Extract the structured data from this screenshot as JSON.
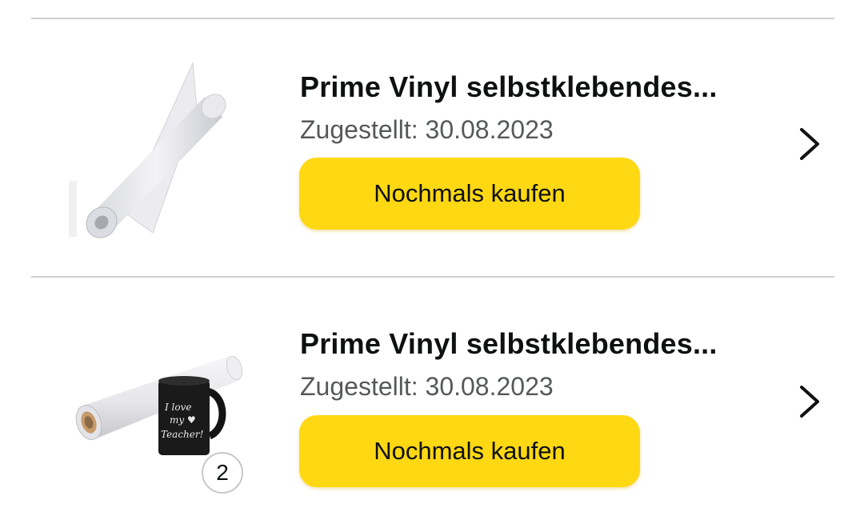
{
  "orders": [
    {
      "title": "Prime Vinyl selbstklebendes...",
      "delivered": "Zugestellt: 30.08.2023",
      "buy_again_label": "Nochmals kaufen",
      "thumbnail": "white-vinyl-roll-image",
      "chevron_icon": "chevron-right-icon"
    },
    {
      "title": "Prime Vinyl selbstklebendes...",
      "delivered": "Zugestellt: 30.08.2023",
      "buy_again_label": "Nochmals kaufen",
      "thumbnail": "vinyl-roll-with-mug-image",
      "mug_text": "I love my Teacher!",
      "quantity": "2",
      "chevron_icon": "chevron-right-icon"
    }
  ],
  "colors": {
    "button_bg": "#ffd814",
    "title_text": "#0f1111",
    "secondary_text": "#565959",
    "divider": "#cfcfcf"
  }
}
